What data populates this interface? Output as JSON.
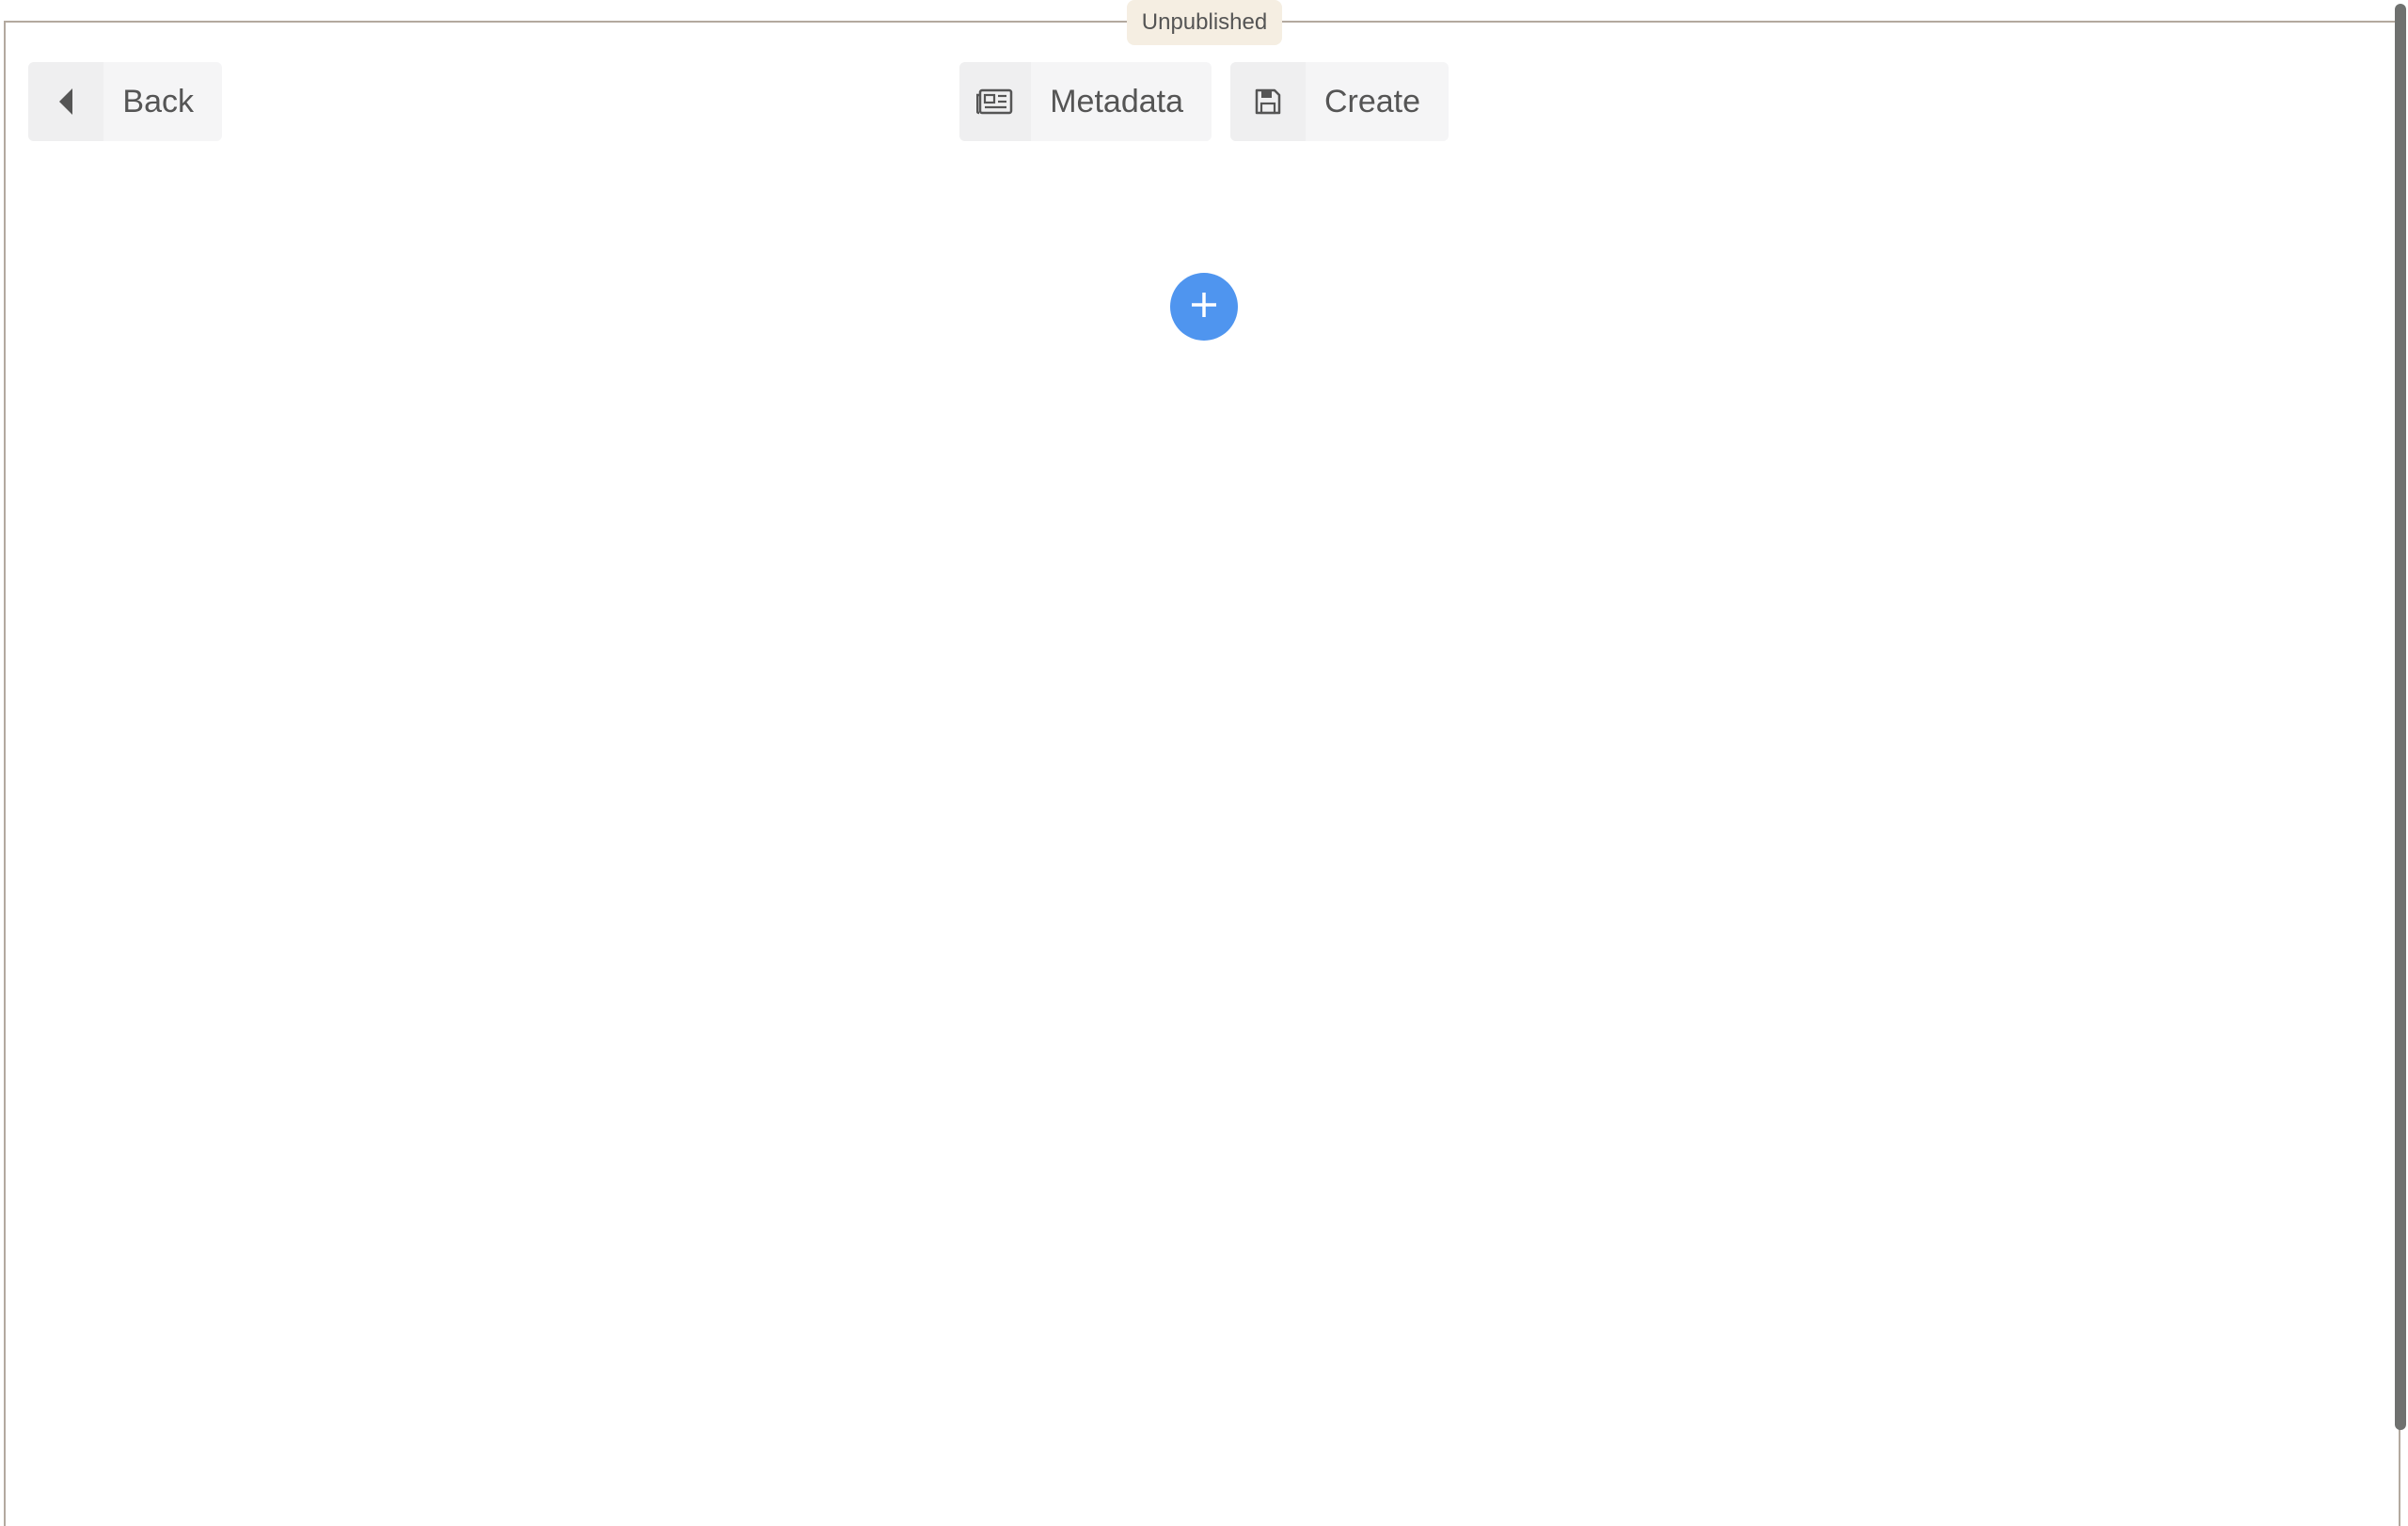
{
  "status": {
    "label": "Unpublished",
    "color": "#f5eee2"
  },
  "toolbar": {
    "back": {
      "label": "Back",
      "icon": "caret-left-icon"
    },
    "metadata": {
      "label": "Metadata",
      "icon": "newspaper-icon"
    },
    "create": {
      "label": "Create",
      "icon": "floppy-disk-icon"
    }
  },
  "editor": {
    "add_block": {
      "icon": "plus-icon",
      "color": "#4f95ef"
    }
  }
}
